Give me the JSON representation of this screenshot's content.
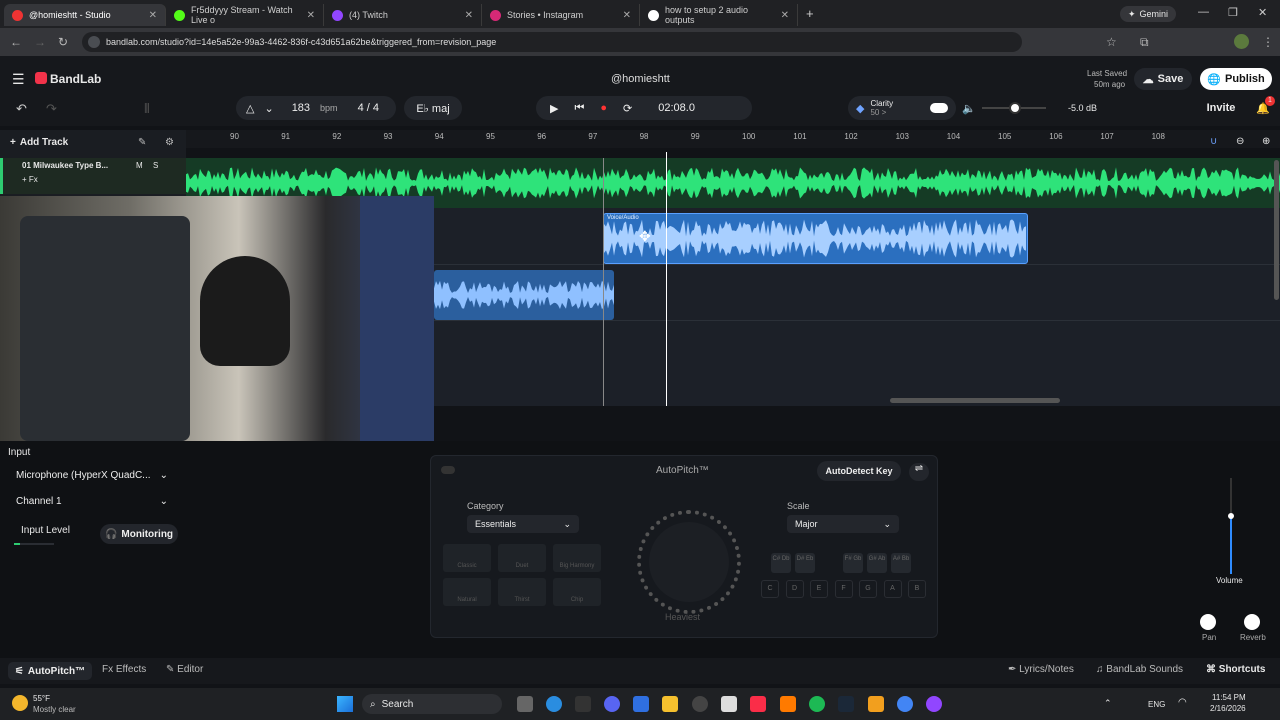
{
  "browser": {
    "tabs": [
      {
        "label": "@homieshtt - Studio",
        "active": true
      },
      {
        "label": "Fr5ddyyy Stream - Watch Live o",
        "active": false
      },
      {
        "label": "(4) Twitch",
        "active": false
      },
      {
        "label": "Stories • Instagram",
        "active": false
      },
      {
        "label": "how to setup 2 audio outputs",
        "active": false
      }
    ],
    "gemini": "Gemini",
    "url": "bandlab.com/studio?id=14e5a52e-99a3-4462-836f-c43d651a62be&triggered_from=revision_page"
  },
  "app": {
    "logo": "BandLab",
    "user": "@homieshtt",
    "last_saved_label": "Last Saved",
    "last_saved_time": "50m ago",
    "save": "Save",
    "publish": "Publish",
    "invite": "Invite",
    "notif_count": "1"
  },
  "toolbar": {
    "bpm": "183",
    "bpm_unit": "bpm",
    "time_sig": "4 / 4",
    "key": "E♭ maj",
    "time": "02:08.0",
    "clarity": "Clarity",
    "clarity_sub": "50 >",
    "volume_db": "-5.0 dB"
  },
  "ruler": [
    "90",
    "91",
    "92",
    "93",
    "94",
    "95",
    "96",
    "97",
    "98",
    "99",
    "100",
    "101",
    "102",
    "103",
    "104",
    "105",
    "106",
    "107",
    "108"
  ],
  "tracks": {
    "add_track": "Add Track",
    "track1_name": "01 Milwaukee Type B...",
    "m": "M",
    "s": "S",
    "fx": "+ Fx",
    "clip_label": "Voice/Audio"
  },
  "input": {
    "title": "Input",
    "device": "Microphone (HyperX QuadC...",
    "channel": "Channel 1",
    "level": "Input Level",
    "monitoring": "Monitoring"
  },
  "autopitch": {
    "title": "AutoPitch™",
    "autodetect": "AutoDetect Key",
    "category_label": "Category",
    "category_value": "Essentials",
    "scale_label": "Scale",
    "scale_value": "Major",
    "effects": [
      "Classic",
      "Duet",
      "Big Harmony",
      "Natural",
      "Thirst",
      "Chip"
    ],
    "knob_label": "Heaviest",
    "keys_top": [
      "C# Db",
      "D# Eb",
      "F# Gb",
      "G# Ab",
      "A# Bb"
    ],
    "keys_bottom": [
      "C",
      "D",
      "E",
      "F",
      "G",
      "A",
      "B"
    ]
  },
  "mixer": {
    "volume": "Volume",
    "pan": "Pan",
    "reverb": "Reverb",
    "volume_level": 0.6
  },
  "bottom": {
    "autopitch": "AutoPitch™",
    "effects": "Effects",
    "editor": "Editor",
    "lyrics": "Lyrics/Notes",
    "sounds": "BandLab Sounds",
    "shortcuts": "Shortcuts"
  },
  "taskbar": {
    "temp": "55°F",
    "weather": "Mostly clear",
    "search": "Search",
    "lang": "ENG",
    "time": "11:54 PM",
    "date": "2/16/2026"
  }
}
